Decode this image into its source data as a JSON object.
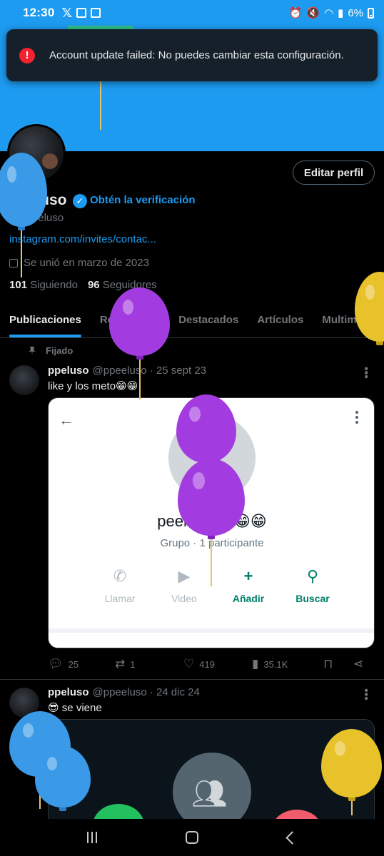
{
  "status_bar": {
    "time": "12:30",
    "battery": "6%"
  },
  "toast": {
    "message": "Account update failed: No puedes cambiar esta configuración."
  },
  "profile": {
    "edit_label": "Editar perfil",
    "name": "ppeluso",
    "verify_label": "Obtén la verificación",
    "handle": "@ppeeluso",
    "bio_link": "instagram.com/invites/contac...",
    "joined": "Se unió en marzo de 2023",
    "following_count": "101",
    "following_label": "Siguiendo",
    "followers_count": "96",
    "followers_label": "Seguidores"
  },
  "tabs": [
    "Publicaciones",
    "Respuestas",
    "Destacados",
    "Artículos",
    "Multimedia"
  ],
  "tweets": [
    {
      "pinned_label": "Fijado",
      "name": "ppeluso",
      "meta": "@ppeeluso · 25 sept 23",
      "text": "like y los meto😁😁",
      "replies": "25",
      "retweets": "1",
      "likes": "419",
      "views": "35.1K",
      "media": {
        "title": "peelu festtt😁😁",
        "subtitle": "Grupo · 1 participante",
        "actions": [
          "Llamar",
          "Video",
          "Añadir",
          "Buscar"
        ]
      }
    },
    {
      "name": "ppeluso",
      "meta": "@ppeeluso · 24 dic 24",
      "text": "😎 se viene"
    }
  ],
  "colors": {
    "accent": "#1d9bf0",
    "error": "#f4212e",
    "whatsapp_green": "#008069",
    "balloon_purple": "#a33ce0",
    "balloon_yellow": "#e8c22a",
    "balloon_blue": "#3a9ae8"
  }
}
